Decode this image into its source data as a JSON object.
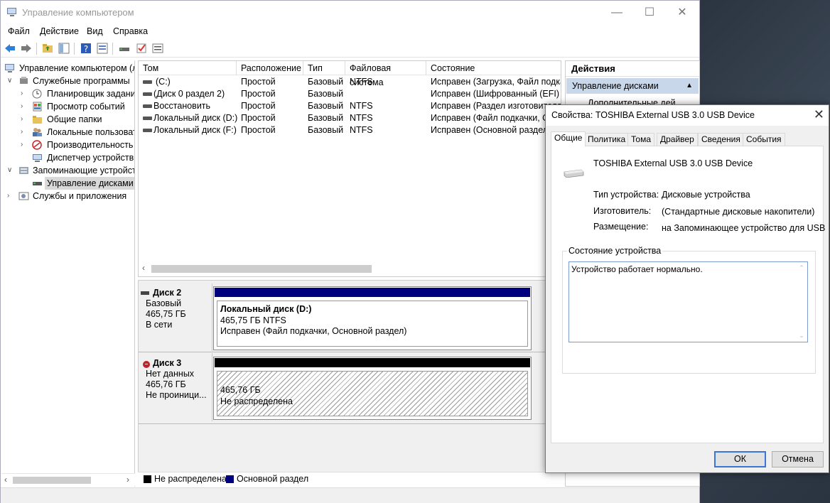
{
  "window": {
    "title": "Управление компьютером"
  },
  "menu": [
    "Файл",
    "Действие",
    "Вид",
    "Справка"
  ],
  "tree": {
    "root": "Управление компьютером (л",
    "utilities": "Служебные программы",
    "scheduler": "Планировщик заданий",
    "eventviewer": "Просмотр событий",
    "sharedfolders": "Общие папки",
    "localusers": "Локальные пользовате",
    "performance": "Производительность",
    "devicemanager": "Диспетчер устройств",
    "storage": "Запоминающие устройств",
    "diskmgmt": "Управление дисками",
    "services": "Службы и приложения"
  },
  "volumes": {
    "columns": [
      "Том",
      "Расположение",
      "Тип",
      "Файловая система",
      "Состояние"
    ],
    "rows": [
      [
        "(C:)",
        "Простой",
        "Базовый",
        "NTFS",
        "Исправен (Загрузка, Файл подкач"
      ],
      [
        "(Диск 0 раздел 2)",
        "Простой",
        "Базовый",
        "",
        "Исправен (Шифрованный (EFI) систе"
      ],
      [
        "Восстановить",
        "Простой",
        "Базовый",
        "NTFS",
        "Исправен (Раздел изготовителя"
      ],
      [
        "Локальный диск (D:)",
        "Простой",
        "Базовый",
        "NTFS",
        "Исправен (Файл подкачки, Основ"
      ],
      [
        "Локальный диск (F:)",
        "Простой",
        "Базовый",
        "NTFS",
        "Исправен (Основной раздел)"
      ]
    ]
  },
  "disks": {
    "disk2": {
      "name": "Диск 2",
      "type": "Базовый",
      "size": "465,75 ГБ",
      "status": "В сети",
      "part_name": "Локальный диск  (D:)",
      "part_size": "465,75 ГБ NTFS",
      "part_status": "Исправен (Файл подкачки, Основной раздел)"
    },
    "disk3": {
      "name": "Диск 3",
      "type": "Нет данных",
      "size": "465,76 ГБ",
      "status": "Не проиници...",
      "part_size": "465,76 ГБ",
      "part_status": "Не распределена"
    }
  },
  "legend": {
    "unallocated": "Не распределена",
    "primary": "Основной раздел"
  },
  "actions": {
    "header": "Действия",
    "section": "Управление дисками",
    "more": "Дополнительные дей..."
  },
  "dialog": {
    "title": "Свойства: TOSHIBA External USB 3.0 USB Device",
    "tabs": [
      "Общие",
      "Политика",
      "Тома",
      "Драйвер",
      "Сведения",
      "События"
    ],
    "device_name": "TOSHIBA External USB 3.0 USB Device",
    "type_label": "Тип устройства:",
    "type_value": "Дисковые устройства",
    "mfr_label": "Изготовитель:",
    "mfr_value": "(Стандартные дисковые накопители)",
    "loc_label": "Размещение:",
    "loc_value": "на Запоминающее устройство для USB",
    "status_group": "Состояние устройства",
    "status_text": "Устройство работает нормально.",
    "ok": "ОК",
    "cancel": "Отмена"
  },
  "colors": {
    "primary_partition": "#00007f",
    "unallocated": "#000000",
    "selection": "#c8d7ea"
  },
  "icons": [
    "back-arrow-icon",
    "forward-arrow-icon",
    "up-folder-icon",
    "console-tree-icon",
    "help-icon",
    "properties-icon",
    "disk-icon",
    "check-icon",
    "list-icon"
  ]
}
